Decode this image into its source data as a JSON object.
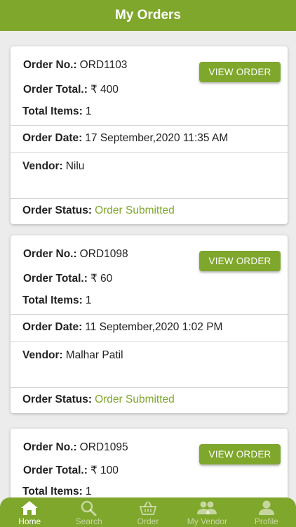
{
  "header": {
    "title": "My Orders"
  },
  "labels": {
    "order_no": "Order No.:",
    "order_total": "Order Total.:",
    "total_items": "Total Items:",
    "order_date": "Order Date:",
    "vendor": "Vendor:",
    "order_status": "Order Status:",
    "view_order": "VIEW ORDER"
  },
  "orders": [
    {
      "order_no": "ORD1103",
      "total": "₹ 400",
      "items": "1",
      "date": "17 September,2020 11:35 AM",
      "vendor": "Nilu",
      "status": "Order Submitted"
    },
    {
      "order_no": "ORD1098",
      "total": "₹ 60",
      "items": "1",
      "date": "11 September,2020 1:02 PM",
      "vendor": "Malhar Patil",
      "status": "Order Submitted"
    },
    {
      "order_no": "ORD1095",
      "total": "₹ 100",
      "items": "1"
    }
  ],
  "nav": [
    {
      "label": "Home",
      "icon": "home-icon",
      "active": true
    },
    {
      "label": "Search",
      "icon": "search-icon",
      "active": false
    },
    {
      "label": "Order",
      "icon": "basket-icon",
      "active": false
    },
    {
      "label": "My Vendor",
      "icon": "people-icon",
      "active": false
    },
    {
      "label": "Profile",
      "icon": "person-icon",
      "active": false
    }
  ],
  "colors": {
    "accent": "#7fa72c",
    "background": "#ececec"
  }
}
